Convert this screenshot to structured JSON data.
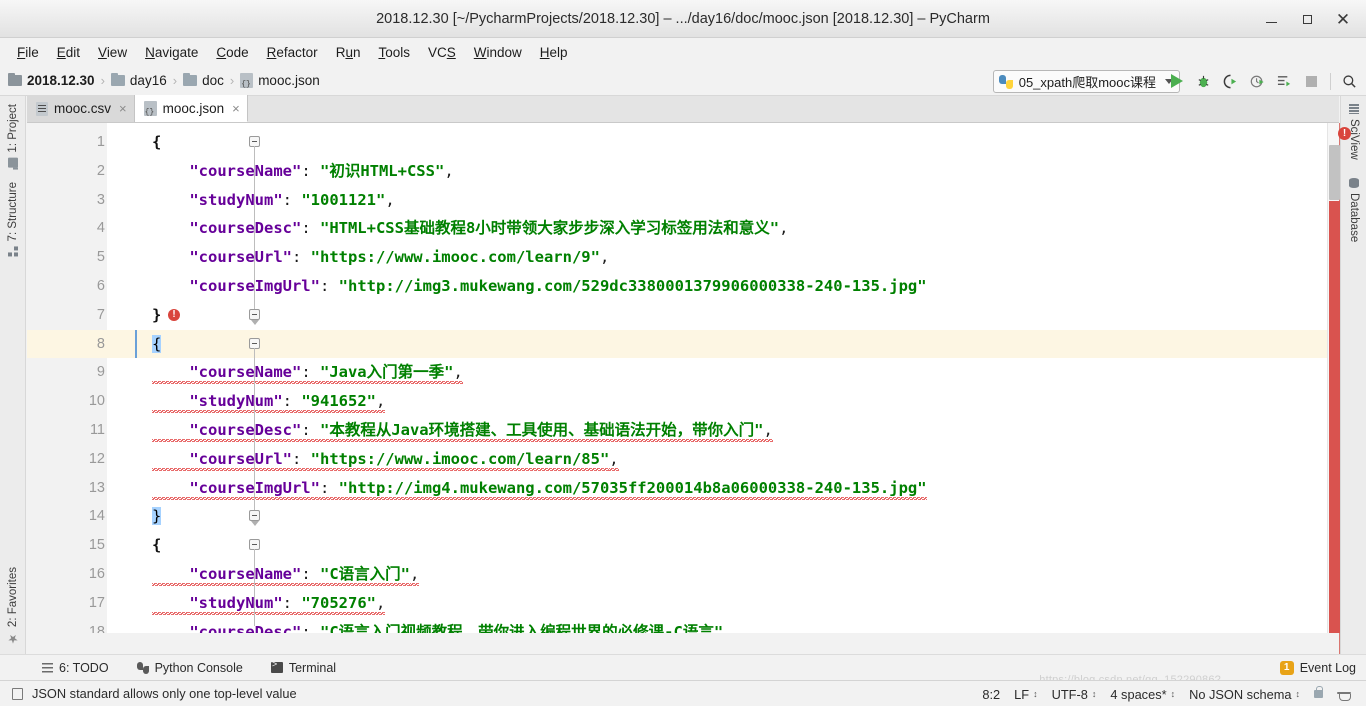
{
  "window": {
    "title": "2018.12.30 [~/PycharmProjects/2018.12.30] – .../day16/doc/mooc.json [2018.12.30] – PyCharm",
    "minimize_label": "–",
    "maximize_label": "□",
    "close_label": "×"
  },
  "menubar": [
    {
      "label": "File"
    },
    {
      "label": "Edit"
    },
    {
      "label": "View"
    },
    {
      "label": "Navigate"
    },
    {
      "label": "Code"
    },
    {
      "label": "Refactor"
    },
    {
      "label": "Run"
    },
    {
      "label": "Tools"
    },
    {
      "label": "VCS"
    },
    {
      "label": "Window"
    },
    {
      "label": "Help"
    }
  ],
  "breadcrumb": {
    "separator": "›",
    "items": [
      {
        "label": "2018.12.30",
        "icon": "folder-icon"
      },
      {
        "label": "day16",
        "icon": "folder-icon"
      },
      {
        "label": "doc",
        "icon": "folder-icon"
      },
      {
        "label": "mooc.json",
        "icon": "json-file-icon"
      }
    ]
  },
  "toolbar": {
    "run_config_label": "05_xpath爬取mooc课程",
    "run_config_icon": "python-icon",
    "icons": [
      {
        "name": "run-icon"
      },
      {
        "name": "debug-icon"
      },
      {
        "name": "run-with-coverage-icon"
      },
      {
        "name": "profile-icon"
      },
      {
        "name": "run-dashboard-icon"
      },
      {
        "name": "stop-icon"
      },
      {
        "name": "search-everywhere-icon"
      }
    ]
  },
  "left_toolstrip": [
    {
      "label": "1: Project",
      "icon": "project-icon"
    },
    {
      "label": "7: Structure",
      "icon": "structure-icon"
    },
    {
      "label": "2: Favorites",
      "icon": "star-icon"
    }
  ],
  "right_toolstrip": [
    {
      "label": "SciView",
      "icon": "sciview-icon"
    },
    {
      "label": "Database",
      "icon": "database-icon"
    }
  ],
  "editor_tabs": [
    {
      "label": "mooc.csv",
      "icon": "csv-file-icon",
      "active": false,
      "close": "×"
    },
    {
      "label": "mooc.json",
      "icon": "json-file-icon",
      "active": true,
      "close": "×"
    }
  ],
  "editor": {
    "current_line": 8,
    "lines": [
      {
        "n": 1,
        "indent": 0,
        "tokens": [
          {
            "t": "brace",
            "v": "{"
          }
        ]
      },
      {
        "n": 2,
        "indent": 1,
        "tokens": [
          {
            "t": "k",
            "v": "\"courseName\""
          },
          {
            "t": "p",
            "v": ": "
          },
          {
            "t": "s",
            "v": "\"初识HTML+CSS\""
          },
          {
            "t": "p",
            "v": ","
          }
        ]
      },
      {
        "n": 3,
        "indent": 1,
        "tokens": [
          {
            "t": "k",
            "v": "\"studyNum\""
          },
          {
            "t": "p",
            "v": ": "
          },
          {
            "t": "s",
            "v": "\"1001121\""
          },
          {
            "t": "p",
            "v": ","
          }
        ]
      },
      {
        "n": 4,
        "indent": 1,
        "tokens": [
          {
            "t": "k",
            "v": "\"courseDesc\""
          },
          {
            "t": "p",
            "v": ": "
          },
          {
            "t": "s",
            "v": "\"HTML+CSS基础教程8小时带领大家步步深入学习标签用法和意义\""
          },
          {
            "t": "p",
            "v": ","
          }
        ]
      },
      {
        "n": 5,
        "indent": 1,
        "tokens": [
          {
            "t": "k",
            "v": "\"courseUrl\""
          },
          {
            "t": "p",
            "v": ": "
          },
          {
            "t": "s",
            "v": "\"https://www.imooc.com/learn/9\""
          },
          {
            "t": "p",
            "v": ","
          }
        ]
      },
      {
        "n": 6,
        "indent": 1,
        "tokens": [
          {
            "t": "k",
            "v": "\"courseImgUrl\""
          },
          {
            "t": "p",
            "v": ": "
          },
          {
            "t": "s",
            "v": "\"http://img3.mukewang.com/529dc3380001379906000338-240-135.jpg\""
          }
        ]
      },
      {
        "n": 7,
        "indent": 0,
        "tokens": [
          {
            "t": "brace",
            "v": "}"
          }
        ]
      },
      {
        "n": 8,
        "indent": 0,
        "tokens": [
          {
            "t": "sel",
            "v": "{"
          }
        ]
      },
      {
        "n": 9,
        "indent": 1,
        "error": true,
        "tokens": [
          {
            "t": "k",
            "v": "\"courseName\""
          },
          {
            "t": "p",
            "v": ": "
          },
          {
            "t": "s",
            "v": "\"Java入门第一季\""
          },
          {
            "t": "p",
            "v": ","
          }
        ]
      },
      {
        "n": 10,
        "indent": 1,
        "error": true,
        "tokens": [
          {
            "t": "k",
            "v": "\"studyNum\""
          },
          {
            "t": "p",
            "v": ": "
          },
          {
            "t": "s",
            "v": "\"941652\""
          },
          {
            "t": "p",
            "v": ","
          }
        ]
      },
      {
        "n": 11,
        "indent": 1,
        "error": true,
        "tokens": [
          {
            "t": "k",
            "v": "\"courseDesc\""
          },
          {
            "t": "p",
            "v": ": "
          },
          {
            "t": "s",
            "v": "\"本教程从Java环境搭建、工具使用、基础语法开始，带你入门\""
          },
          {
            "t": "p",
            "v": ","
          }
        ]
      },
      {
        "n": 12,
        "indent": 1,
        "error": true,
        "tokens": [
          {
            "t": "k",
            "v": "\"courseUrl\""
          },
          {
            "t": "p",
            "v": ": "
          },
          {
            "t": "s",
            "v": "\"https://www.imooc.com/learn/85\""
          },
          {
            "t": "p",
            "v": ","
          }
        ]
      },
      {
        "n": 13,
        "indent": 1,
        "error": true,
        "tokens": [
          {
            "t": "k",
            "v": "\"courseImgUrl\""
          },
          {
            "t": "p",
            "v": ": "
          },
          {
            "t": "s",
            "v": "\"http://img4.mukewang.com/57035ff200014b8a06000338-240-135.jpg\""
          }
        ]
      },
      {
        "n": 14,
        "indent": 0,
        "tokens": [
          {
            "t": "sel",
            "v": "}"
          }
        ]
      },
      {
        "n": 15,
        "indent": 0,
        "tokens": [
          {
            "t": "brace",
            "v": "{"
          }
        ]
      },
      {
        "n": 16,
        "indent": 1,
        "error": true,
        "tokens": [
          {
            "t": "k",
            "v": "\"courseName\""
          },
          {
            "t": "p",
            "v": ": "
          },
          {
            "t": "s",
            "v": "\"C语言入门\""
          },
          {
            "t": "p",
            "v": ","
          }
        ]
      },
      {
        "n": 17,
        "indent": 1,
        "error": true,
        "tokens": [
          {
            "t": "k",
            "v": "\"studyNum\""
          },
          {
            "t": "p",
            "v": ": "
          },
          {
            "t": "s",
            "v": "\"705276\""
          },
          {
            "t": "p",
            "v": ","
          }
        ]
      },
      {
        "n": 18,
        "indent": 1,
        "error": true,
        "tokens": [
          {
            "t": "k",
            "v": "\"courseDesc\""
          },
          {
            "t": "p",
            "v": ": "
          },
          {
            "t": "s",
            "v": "\"C语言入门视频教程，带你进入编程世界的必修课-C语言\""
          },
          {
            "t": "p",
            "v": ","
          }
        ]
      }
    ],
    "error_marker": "!"
  },
  "bottom_tabs": [
    {
      "label": "6: TODO",
      "icon": "todo-icon"
    },
    {
      "label": "Python Console",
      "icon": "python-console-icon"
    },
    {
      "label": "Terminal",
      "icon": "terminal-icon"
    }
  ],
  "event_log": {
    "label": "Event Log",
    "badge": "1"
  },
  "statusbar": {
    "message": "JSON standard allows only one top-level value",
    "caret_position": "8:2",
    "line_separator": "LF",
    "encoding": "UTF-8",
    "indent": "4 spaces*",
    "schema": "No JSON schema",
    "lock_icon": "lock-icon",
    "inspection_icon": "inspection-hat-icon"
  },
  "watermark": "https://blog.csdn.net/qq_15229086?",
  "colors": {
    "key": "#660099",
    "string": "#008000",
    "error": "#d9453d",
    "current_line": "#fdf6e3",
    "selection": "#a6d2ff",
    "accent_green": "#4caf50"
  }
}
